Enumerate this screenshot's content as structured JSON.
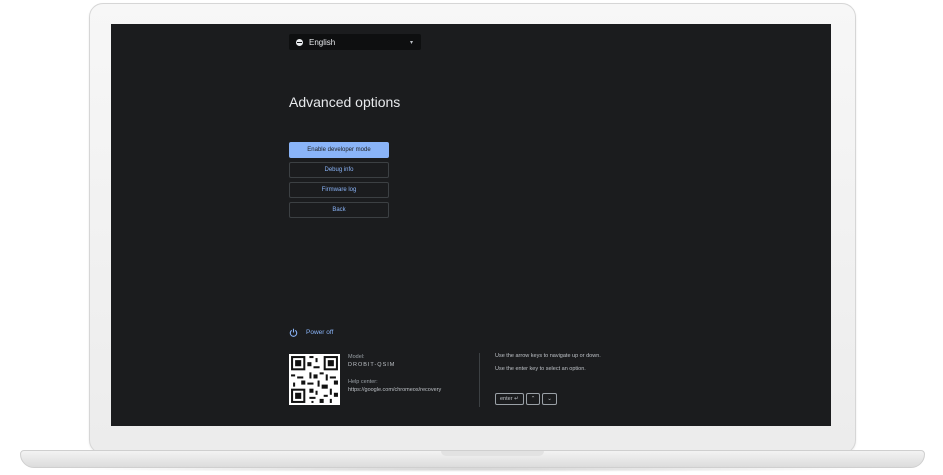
{
  "language": {
    "icon": "globe-icon",
    "label": "English",
    "caret": "▾"
  },
  "page": {
    "title": "Advanced options"
  },
  "menu": {
    "items": [
      {
        "label": "Enable developer mode",
        "selected": true
      },
      {
        "label": "Debug info"
      },
      {
        "label": "Firmware log"
      },
      {
        "label": "Back"
      }
    ]
  },
  "power": {
    "icon": "power-icon",
    "label": "Power off"
  },
  "device": {
    "model_label": "Model:",
    "model_value": "DROBIT-QSIM",
    "help_label": "Help center:",
    "help_url": "https://google.com/chromeos/recovery"
  },
  "hints": {
    "line1": "Use the arrow keys to navigate up or down.",
    "line2": "Use the enter key to select an option.",
    "keys": {
      "enter": "enter ↵",
      "up": "⌃",
      "down": "⌄"
    }
  },
  "colors": {
    "screen_bg": "#1b1c1e",
    "accent": "#8ab4f8",
    "text": "#e8eaed"
  }
}
